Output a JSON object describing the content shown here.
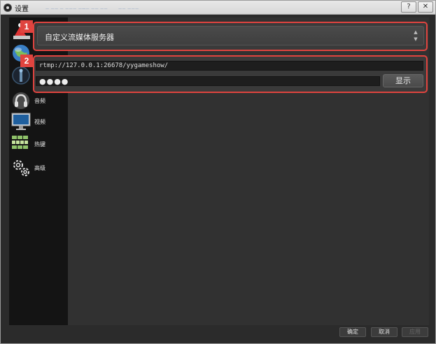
{
  "window": {
    "title": "设置"
  },
  "titlebar": {
    "faint_left": "— —— — ——— ——",
    "faint_mid": "—— ——  ——",
    "faint_right": "—— ———",
    "help_label": "?",
    "close_label": "✕"
  },
  "sidebar": {
    "items": [
      {
        "label": "",
        "icon": "broadcast-icon"
      },
      {
        "label": "",
        "icon": "globe-icon"
      },
      {
        "label": "",
        "icon": "signal-icon"
      },
      {
        "label": "音频",
        "icon": "headset-icon"
      },
      {
        "label": "视频",
        "icon": "monitor-icon"
      },
      {
        "label": "热键",
        "icon": "keyboard-icon"
      },
      {
        "label": "高级",
        "icon": "gears-icon"
      }
    ]
  },
  "stream": {
    "service_badge": "1",
    "service_value": "自定义流媒体服务器",
    "server_badge": "2",
    "server_url": "rtmp://127.0.0.1:26678/yygameshow/",
    "stream_key_masked": "●●●●",
    "show_button": "显示"
  },
  "footer": {
    "ok": "确定",
    "cancel": "取消",
    "apply": "应用"
  },
  "colors": {
    "highlight": "#e0443f",
    "background": "#2b2b2b",
    "sidebar": "#141414"
  }
}
